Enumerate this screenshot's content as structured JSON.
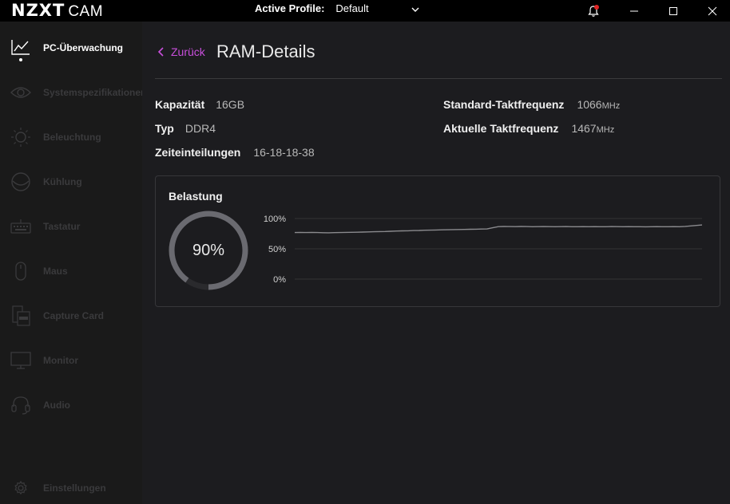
{
  "titlebar": {
    "brand": "NZXT",
    "app_name": "CAM",
    "profile_label": "Active Profile:",
    "profile_value": "Default"
  },
  "sidebar": {
    "items": [
      {
        "label": "PC-Überwachung",
        "icon": "line-chart-icon",
        "active": true
      },
      {
        "label": "Systemspezifikationen",
        "icon": "eye-icon",
        "active": false
      },
      {
        "label": "Beleuchtung",
        "icon": "sun-icon",
        "active": false
      },
      {
        "label": "Kühlung",
        "icon": "cooling-fan-icon",
        "active": false
      },
      {
        "label": "Tastatur",
        "icon": "keyboard-icon",
        "active": false
      },
      {
        "label": "Maus",
        "icon": "mouse-icon",
        "active": false
      },
      {
        "label": "Capture Card",
        "icon": "capture-card-icon",
        "active": false
      },
      {
        "label": "Monitor",
        "icon": "monitor-icon",
        "active": false
      },
      {
        "label": "Audio",
        "icon": "headset-icon",
        "active": false
      }
    ],
    "settings_label": "Einstellungen"
  },
  "main": {
    "back_label": "Zurück",
    "title": "RAM-Details",
    "specs": {
      "capacity_label": "Kapazität",
      "capacity_value": "16GB",
      "type_label": "Typ",
      "type_value": "DDR4",
      "timings_label": "Zeiteinteilungen",
      "timings_value": "16-18-18-38",
      "std_freq_label": "Standard-Taktfrequenz",
      "std_freq_value": "1066",
      "std_freq_unit": "MHz",
      "cur_freq_label": "Aktuelle Taktfrequenz",
      "cur_freq_value": "1467",
      "cur_freq_unit": "MHz"
    },
    "load": {
      "title": "Belastung",
      "gauge_value": 90,
      "gauge_text": "90%"
    }
  },
  "colors": {
    "accent": "#c94fdc",
    "notification": "#e02424",
    "gauge_fill": "#6a6a70",
    "gauge_track": "#2a2a2d",
    "line": "#8a8a8e"
  },
  "chart_data": {
    "type": "line",
    "title": "",
    "xlabel": "",
    "ylabel": "",
    "ylim": [
      0,
      100
    ],
    "yticks": [
      "100%",
      "50%",
      "0%"
    ],
    "series": [
      {
        "values": [
          76.8,
          77.0,
          76.9,
          77.0,
          76.8,
          76.6,
          76.5,
          76.7,
          76.9,
          77.1,
          77.3,
          77.4,
          77.6,
          77.9,
          78.1,
          78.4,
          78.6,
          78.9,
          79.3,
          79.6,
          79.8,
          80.1,
          80.3,
          80.6,
          80.8,
          81.0,
          81.3,
          81.5,
          81.7,
          81.9,
          82.0,
          82.2,
          82.4,
          82.6,
          82.7,
          84.8,
          86.6,
          86.8,
          86.7,
          86.6,
          86.8,
          86.7,
          86.5,
          86.6,
          86.7,
          86.6,
          86.5,
          86.6,
          86.7,
          86.5,
          86.4,
          86.6,
          86.5,
          86.6,
          86.4,
          86.5,
          86.7,
          86.6,
          86.5,
          86.6,
          86.4,
          86.5,
          86.3,
          86.4,
          86.6,
          86.4,
          86.5,
          86.6,
          86.4,
          87.0,
          87.8,
          88.6,
          89.4
        ]
      }
    ]
  }
}
